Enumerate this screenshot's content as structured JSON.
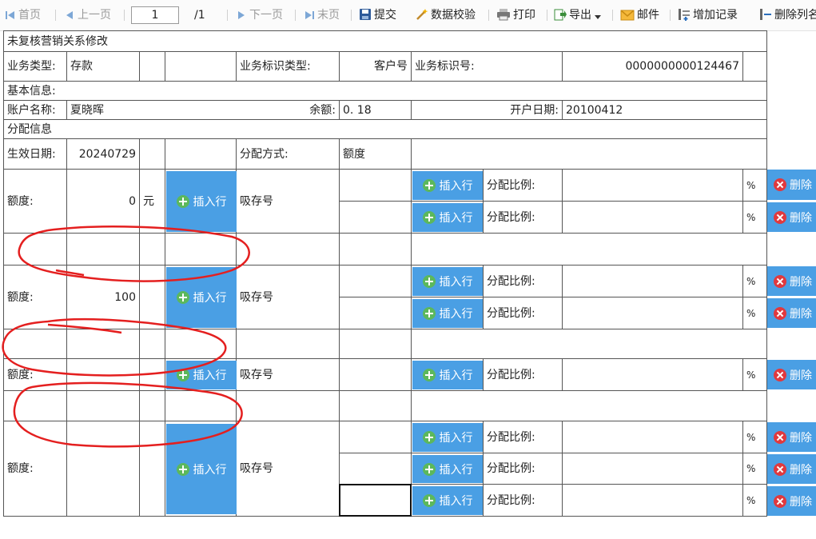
{
  "toolbar": {
    "first": "首页",
    "prev": "上一页",
    "page_value": "1",
    "page_total": "/1",
    "next": "下一页",
    "last": "末页",
    "submit": "提交",
    "validate": "数据校验",
    "print": "打印",
    "export": "导出",
    "mail": "邮件",
    "add_record": "增加记录",
    "delete_col": "删除列名"
  },
  "form": {
    "title": "未复核营销关系修改",
    "biz_type_label": "业务类型:",
    "biz_type_value": "存款",
    "biz_id_type_label": "业务标识类型:",
    "biz_id_type_value": "客户号",
    "biz_id_label": "业务标识号:",
    "biz_id_value": "0000000000124467",
    "basic_info": "基本信息:",
    "account_name_label": "账户名称:",
    "account_name_value": "夏晓晖",
    "balance_label": "余额:",
    "balance_value": "0. 18",
    "open_date_label": "开户日期:",
    "open_date_value": "20100412",
    "alloc_info": "分配信息",
    "effective_date_label": "生效日期:",
    "effective_date_value": "20240729",
    "alloc_method_label": "分配方式:",
    "alloc_method_value": "额度"
  },
  "labels": {
    "quota": "额度:",
    "insert_row": "插入行",
    "absorb_no": "吸存号",
    "ratio": "分配比例:",
    "percent": "%",
    "delete": "删除",
    "yuan": "元"
  },
  "groups": {
    "g1_quota": "0",
    "g2_quota": "100"
  }
}
